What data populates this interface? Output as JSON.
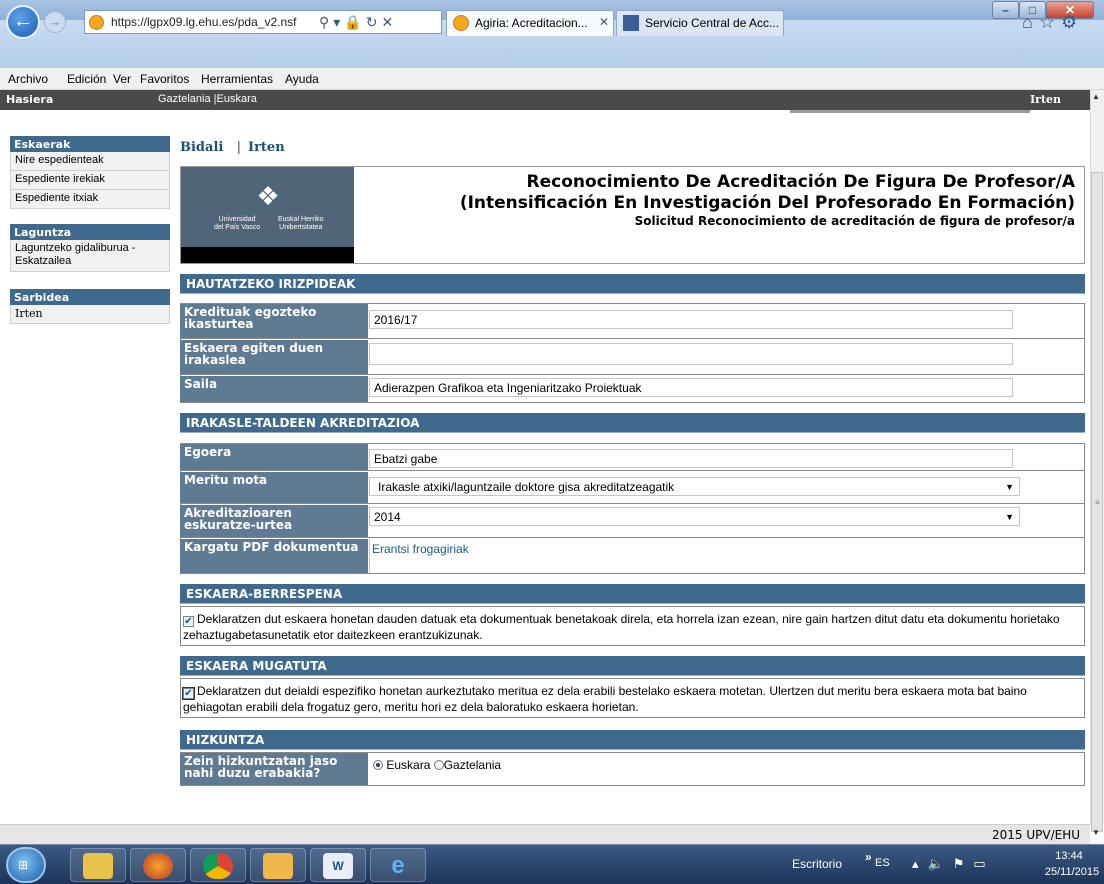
{
  "browser": {
    "url": "https://lgpx09.lg.ehu.es/pda_v2.nsf",
    "tabs": [
      {
        "label": "Agiria: Acreditacion..."
      },
      {
        "label": "Servicio Central de Acc..."
      }
    ],
    "menu": [
      "Archivo",
      "Edición",
      "Ver",
      "Favoritos",
      "Herramientas",
      "Ayuda"
    ]
  },
  "header": {
    "home": "Hasiera",
    "lang_es": "Gaztelania",
    "lang_sep": "|",
    "lang_eu": "Euskara",
    "exit": "Irten"
  },
  "sidebar": {
    "sections": [
      {
        "title": "Eskaerak",
        "items": [
          "Nire espedienteak",
          "Espediente irekiak",
          "Espediente itxiak"
        ]
      },
      {
        "title": "Laguntza",
        "items": [
          "Laguntzeko gidaliburua - Eskatzailea"
        ]
      },
      {
        "title": "Sarbidea",
        "items": [
          "Irten"
        ]
      }
    ]
  },
  "actions": {
    "send": "Bidali",
    "sep": "|",
    "exit": "Irten"
  },
  "banner": {
    "logo_left": "Universidad\ndel País Vasco",
    "logo_right": "Euskal Herriko\nUnibertsitatea",
    "title": "Reconocimiento De Acreditación De Figura De Profesor/A\n(Intensificación En Investigación Del Profesorado En Formación)",
    "subtitle": "Solicitud Reconocimiento de acreditación de figura de profesor/a"
  },
  "criteria": {
    "section_title": "HAUTATZEKO IRIZPIDEAK",
    "course_label": "Kredituak egozteko ikasturtea",
    "course_value": "2016/17",
    "teacher_label": "Eskaera egiten duen irakaslea",
    "teacher_value": "",
    "dept_label": "Saila",
    "dept_value": "Adierazpen Grafikoa eta Ingeniaritzako Proiektuak"
  },
  "accreditation": {
    "section_title": "IRAKASLE-TALDEEN AKREDITAZIOA",
    "status_label": "Egoera",
    "status_value": "Ebatzi gabe",
    "merit_label": "Meritu mota",
    "merit_value": "Irakasle atxiki/laguntzaile doktore gisa akreditatzeagatik",
    "year_label": "Akreditazioaren eskuratze-urtea",
    "year_value": "2014",
    "pdf_label": "Kargatu PDF dokumentua",
    "pdf_link": "Erantsi frogagiriak"
  },
  "responsibility": {
    "section_title": "ESKAERA-BERRESPENA",
    "text": "Deklaratzen dut eskaera honetan dauden datuak eta dokumentuak benetakoak direla, eta horrela izan ezean, nire gain hartzen ditut datu eta dokumentu horietako zehaztugabetasunetatik etor daitezkeen erantzukizunak.",
    "checked": true
  },
  "limited": {
    "section_title": "ESKAERA MUGATUTA",
    "text": "Deklaratzen dut deialdi espezifiko honetan aurkeztutako meritua ez dela erabili bestelako eskaera motetan. Ulertzen dut meritu bera eskaera mota bat baino gehiagotan erabili dela frogatuz gero, meritu hori ez dela baloratuko eskaera horietan.",
    "checked": true
  },
  "language": {
    "section_title": "HIZKUNTZA",
    "question": "Zein hizkuntzatan jaso nahi duzu erabakia?",
    "options": [
      "Euskara",
      "Gaztelania"
    ],
    "selected": "Euskara"
  },
  "footer": {
    "copyright": "2015 UPV/EHU"
  },
  "taskbar": {
    "desktop": "Escritorio",
    "chevron": "»",
    "lang": "ES",
    "time": "13:44",
    "date": "25/11/2015"
  },
  "colors": {
    "section_header": "#3f6a8e",
    "label_cell": "#5f7a93",
    "link": "#1e4f7e"
  }
}
